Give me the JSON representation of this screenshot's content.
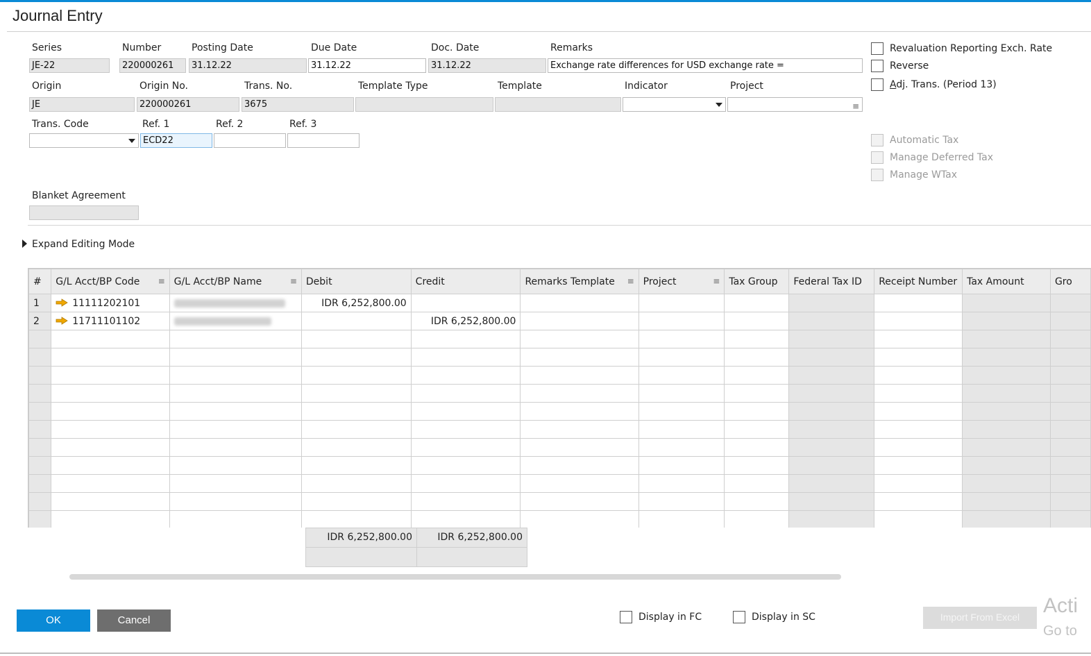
{
  "window": {
    "title": "Journal Entry"
  },
  "header": {
    "series": {
      "label": "Series",
      "value": "JE-22"
    },
    "number": {
      "label": "Number",
      "value": "220000261"
    },
    "posting_date": {
      "label": "Posting Date",
      "value": "31.12.22"
    },
    "due_date": {
      "label": "Due Date",
      "value": "31.12.22"
    },
    "doc_date": {
      "label": "Doc. Date",
      "value": "31.12.22"
    },
    "remarks": {
      "label": "Remarks",
      "value": "Exchange rate differences for USD exchange rate ="
    },
    "origin": {
      "label": "Origin",
      "value": "JE"
    },
    "origin_no": {
      "label": "Origin No.",
      "value": "220000261"
    },
    "trans_no": {
      "label": "Trans. No.",
      "value": "3675"
    },
    "template_type": {
      "label": "Template Type",
      "value": ""
    },
    "template": {
      "label": "Template",
      "value": ""
    },
    "indicator": {
      "label": "Indicator",
      "value": ""
    },
    "project": {
      "label": "Project",
      "value": ""
    },
    "trans_code": {
      "label": "Trans. Code",
      "value": ""
    },
    "ref1": {
      "label": "Ref. 1",
      "value": "ECD22"
    },
    "ref2": {
      "label": "Ref. 2",
      "value": ""
    },
    "ref3": {
      "label": "Ref. 3",
      "value": ""
    },
    "blanket_agreement": {
      "label": "Blanket Agreement",
      "value": ""
    }
  },
  "options": {
    "revaluation": {
      "label": "Revaluation Reporting Exch. Rate",
      "checked": false
    },
    "reverse": {
      "label": "Reverse",
      "checked": false
    },
    "adj_trans_prefix": "A",
    "adj_trans_rest": "dj. Trans. (Period 13)",
    "automatic_tax": {
      "label": "Automatic Tax",
      "enabled": false
    },
    "manage_deferred_tax": {
      "label": "Manage Deferred Tax",
      "enabled": false
    },
    "manage_wtax": {
      "label": "Manage WTax",
      "enabled": false
    }
  },
  "expand_editing_mode": "Expand Editing Mode",
  "grid": {
    "columns": [
      "#",
      "G/L Acct/BP Code",
      "G/L Acct/BP Name",
      "Debit",
      "Credit",
      "Remarks Template",
      "Project",
      "Tax Group",
      "Federal Tax ID",
      "Receipt Number",
      "Tax Amount",
      "Gro"
    ],
    "rows": [
      {
        "num": "1",
        "code": "11111202101",
        "debit": "IDR 6,252,800.00",
        "credit": ""
      },
      {
        "num": "2",
        "code": "11711101102",
        "debit": "",
        "credit": "IDR 6,252,800.00"
      }
    ],
    "totals": {
      "debit": "IDR 6,252,800.00",
      "credit": "IDR 6,252,800.00"
    }
  },
  "footer": {
    "ok": "OK",
    "cancel": "Cancel",
    "display_fc": "Display in FC",
    "display_sc": "Display in SC",
    "import_from_excel": "Import From Excel"
  },
  "watermark": {
    "line1": "Acti",
    "line2": "Go to"
  },
  "colors": {
    "accent": "#0a8ad6",
    "readonly_bg": "#e6e6e6",
    "arrow": "#f0a800"
  }
}
